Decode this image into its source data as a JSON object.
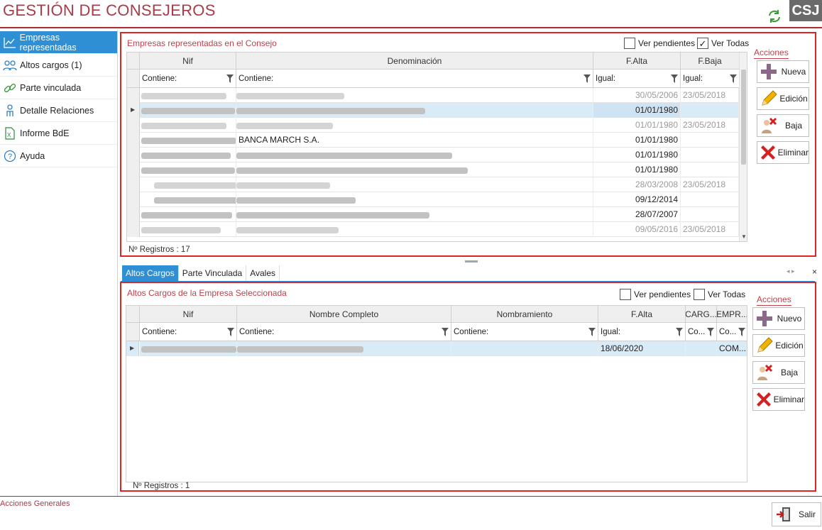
{
  "header": {
    "title": "GESTIÓN DE CONSEJEROS",
    "logo_text": "CSJ",
    "refresh_icon": "refresh-icon"
  },
  "colors": {
    "accent": "#2f8fd4",
    "brand": "#a93b47",
    "highlight_border": "#e02424"
  },
  "sidebar": {
    "items": [
      {
        "label": "Empresas representadas",
        "icon": "chart-icon",
        "active": true
      },
      {
        "label": "Altos cargos (1)",
        "icon": "users-icon",
        "active": false
      },
      {
        "label": "Parte vinculada",
        "icon": "link-icon",
        "active": false
      },
      {
        "label": "Detalle Relaciones",
        "icon": "person-icon",
        "active": false
      },
      {
        "label": "Informe BdE",
        "icon": "excel-icon",
        "active": false
      },
      {
        "label": "Ayuda",
        "icon": "help-icon",
        "active": false
      }
    ]
  },
  "top": {
    "title": "Empresas representadas  en  el  Consejo",
    "ver_pendientes": {
      "label": "Ver pendientes",
      "checked": false
    },
    "ver_todas": {
      "label": "Ver Todas",
      "checked": true
    },
    "columns": [
      "Nif",
      "Denominación",
      "F.Alta",
      "F.Baja"
    ],
    "filters": [
      "Contiene:",
      "Contiene:",
      "Igual:",
      "Igual:"
    ],
    "rows": [
      {
        "nif": "",
        "den": "",
        "alta": "30/05/2006",
        "baja": "23/05/2018",
        "dim": true,
        "selected": false
      },
      {
        "nif": "",
        "den": "",
        "alta": "01/01/1980",
        "baja": "",
        "dim": false,
        "selected": true
      },
      {
        "nif": "",
        "den": "",
        "alta": "01/01/1980",
        "baja": "23/05/2018",
        "dim": true,
        "selected": false
      },
      {
        "nif": "",
        "den": "BANCA MARCH S.A.",
        "alta": "01/01/1980",
        "baja": "",
        "dim": false,
        "selected": false
      },
      {
        "nif": "",
        "den": "",
        "alta": "01/01/1980",
        "baja": "",
        "dim": false,
        "selected": false
      },
      {
        "nif": "",
        "den": "",
        "alta": "01/01/1980",
        "baja": "",
        "dim": false,
        "selected": false
      },
      {
        "nif": "",
        "den": "",
        "alta": "28/03/2008",
        "baja": "23/05/2018",
        "dim": true,
        "selected": false
      },
      {
        "nif": "",
        "den": "",
        "alta": "09/12/2014",
        "baja": "",
        "dim": false,
        "selected": false
      },
      {
        "nif": "",
        "den": "",
        "alta": "28/07/2007",
        "baja": "",
        "dim": false,
        "selected": false
      },
      {
        "nif": "",
        "den": "",
        "alta": "09/05/2016",
        "baja": "23/05/2018",
        "dim": true,
        "selected": false
      }
    ],
    "count_label": "Nº Registros : 17",
    "actions_label": "Acciones",
    "buttons": {
      "nueva": "Nueva",
      "edicion": "Edición",
      "baja": "Baja",
      "eliminar": "Eliminar"
    }
  },
  "bottom": {
    "tabs": [
      {
        "label": "Altos Cargos",
        "active": true
      },
      {
        "label": "Parte Vinculada",
        "active": false
      },
      {
        "label": "Avales",
        "active": false
      }
    ],
    "title": "Altos Cargos de la Empresa Seleccionada",
    "ver_pendientes": {
      "label": "Ver pendientes",
      "checked": false
    },
    "ver_todas": {
      "label": "Ver Todas",
      "checked": false
    },
    "columns": [
      "Nif",
      "Nombre Completo",
      "Nombramiento",
      "F.Alta",
      "CARG...",
      "EMPR..."
    ],
    "filters": [
      "Contiene:",
      "Contiene:",
      "Contiene:",
      "Igual:",
      "Co...",
      "Co..."
    ],
    "rows": [
      {
        "nif": "",
        "nombre": "",
        "nombramiento": "",
        "alta": "18/06/2020",
        "cargo": "",
        "empresa": "COM..."
      }
    ],
    "count_label": "Nº Registros : 1",
    "actions_label": "Acciones",
    "buttons": {
      "nuevo": "Nuevo",
      "edicion": "Edición",
      "baja": "Baja",
      "eliminar": "Eliminar"
    }
  },
  "footer": {
    "label": "Acciones Generales",
    "salir": "Salir"
  }
}
